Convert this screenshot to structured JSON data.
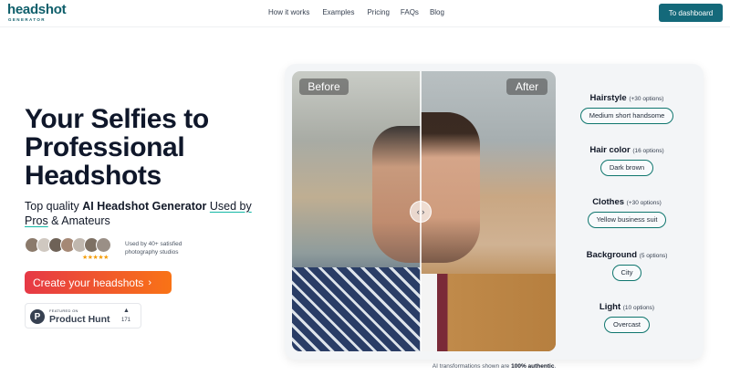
{
  "nav": {
    "logo": "headshot",
    "logo_sub": "GENERATOR",
    "links": [
      "How it works",
      "Examples",
      "Pricing",
      "FAQs",
      "Blog"
    ],
    "dashboard_button": "To dashboard"
  },
  "hero": {
    "title_line1": "Your Selfies to",
    "title_line2": "Professional",
    "title_line3": "Headshots",
    "subtitle_prefix": "Top quality ",
    "subtitle_bold": "AI Headshot Generator",
    "subtitle_link1": "Used by",
    "subtitle_link2": "Pros",
    "subtitle_suffix": " & Amateurs",
    "social_proof": "Used by 40+ satisfied photography studios",
    "stars": "★★★★★",
    "cta": "Create your headshots",
    "cta_arrow": "›",
    "product_hunt": {
      "featured": "FEATURED ON",
      "name": "Product Hunt",
      "logo": "P",
      "upvote_icon": "▲",
      "count": "171"
    }
  },
  "preview": {
    "before_label": "Before",
    "after_label": "After",
    "handle_icon": "‹ ›",
    "options": [
      {
        "label": "Hairstyle",
        "count": "(+30 options)",
        "value": "Medium short handsome"
      },
      {
        "label": "Hair color",
        "count": "(16 options)",
        "value": "Dark brown"
      },
      {
        "label": "Clothes",
        "count": "(+30 options)",
        "value": "Yellow business suit"
      },
      {
        "label": "Background",
        "count": "(5 options)",
        "value": "City"
      },
      {
        "label": "Light",
        "count": "(10 options)",
        "value": "Overcast"
      }
    ],
    "footnote_prefix": "AI transformations shown are ",
    "footnote_bold": "100% authentic",
    "footnote_suffix": "."
  }
}
